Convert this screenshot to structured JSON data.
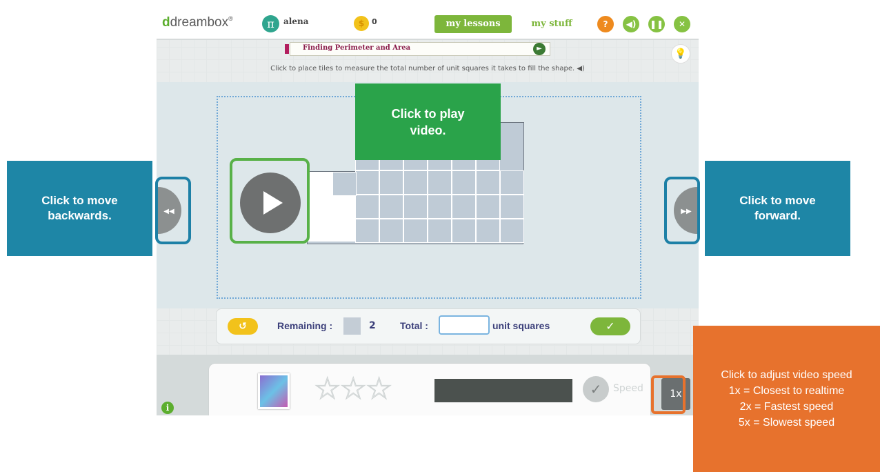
{
  "topbar": {
    "logo_d": "d",
    "logo_text": "dreambox",
    "logo_tm": "®",
    "pi_symbol": "π",
    "username": "alena",
    "coin_symbol": "$",
    "coin_count": "0",
    "tab_lessons": "my lessons",
    "tab_stuff": "my stuff",
    "help": "?",
    "sound": "◀)",
    "pause": "❚❚",
    "close": "✕"
  },
  "lesson": {
    "title": "Finding Perimeter and Area",
    "go_symbol": "►"
  },
  "hint_symbol": "💡",
  "instruction": "Click to place tiles to measure the total number of unit squares it takes to fill the shape. ◀)",
  "controls": {
    "undo": "↺",
    "remaining_label": "Remaining :",
    "remaining_value": "2",
    "total_label": "Total :",
    "total_value": "",
    "unit_label": "unit squares",
    "check": "✓"
  },
  "bottom": {
    "stars": "☆☆☆",
    "speed_word": "Speed",
    "speed_value": "1x",
    "info": "i",
    "seal": "✓"
  },
  "nav": {
    "back_glyph": "◀◀",
    "fwd_glyph": "▶▶"
  },
  "callouts": {
    "back": "Click to move backwards.",
    "play": "Click to play video.",
    "forward": "Click to move forward.",
    "speed_lines": [
      "Click to adjust video speed",
      "1x = Closest to realtime",
      "2x = Fastest speed",
      "5x = Slowest speed"
    ]
  },
  "colors": {
    "callout_blue": "#1e86a6",
    "callout_green": "#2aa34a",
    "callout_orange": "#e7722d",
    "brand_green": "#7db63b"
  }
}
